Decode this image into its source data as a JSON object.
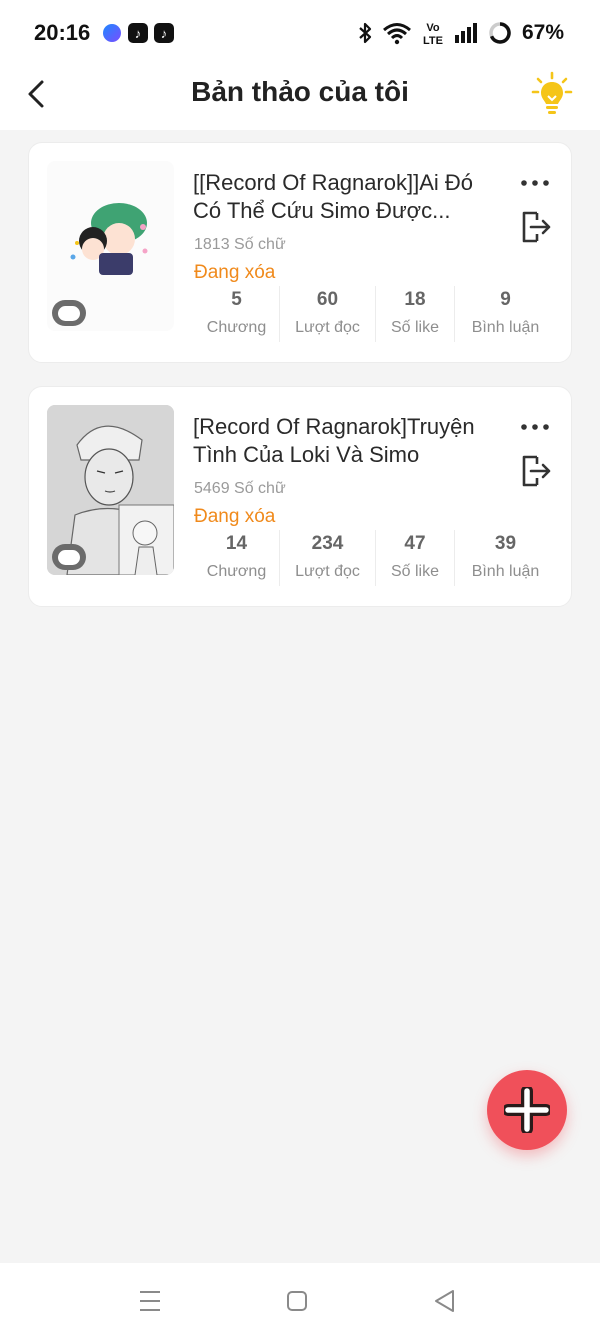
{
  "status_bar": {
    "time": "20:16",
    "battery": "67%",
    "notification_icons": [
      "messenger-icon",
      "tiktok-icon",
      "tiktok-icon"
    ],
    "system_icons": [
      "bluetooth-icon",
      "wifi-icon",
      "volte-icon",
      "signal-icon",
      "battery-ring-icon"
    ],
    "volte_top": "Vo",
    "volte_bottom": "LTE"
  },
  "header": {
    "title": "Bản thảo của tôi",
    "back_icon": "chevron-left-icon",
    "tip_icon": "lightbulb-icon"
  },
  "drafts": [
    {
      "title": "[[Record Of Ragnarok]]Ai Đó Có Thể Cứu Simo Được...",
      "word_count": "1813 Số chữ",
      "status": "Đang xóa",
      "stats": [
        {
          "value": "5",
          "label": "Chương"
        },
        {
          "value": "60",
          "label": "Lượt đọc"
        },
        {
          "value": "18",
          "label": "Số like"
        },
        {
          "value": "9",
          "label": "Bình luận"
        }
      ]
    },
    {
      "title": "[Record Of Ragnarok]Truyện Tình Của Loki Và Simo",
      "word_count": "5469 Số chữ",
      "status": "Đang xóa",
      "stats": [
        {
          "value": "14",
          "label": "Chương"
        },
        {
          "value": "234",
          "label": "Lượt đọc"
        },
        {
          "value": "47",
          "label": "Số like"
        },
        {
          "value": "39",
          "label": "Bình luận"
        }
      ]
    }
  ],
  "fab": {
    "icon": "plus-icon"
  },
  "nav_bar": {
    "icons": [
      "menu-icon",
      "home-icon",
      "back-triangle-icon"
    ]
  },
  "colors": {
    "accent_orange": "#f08a1c",
    "fab_red": "#f0505a",
    "bulb_yellow": "#f5c518",
    "background": "#f4f4f4"
  }
}
